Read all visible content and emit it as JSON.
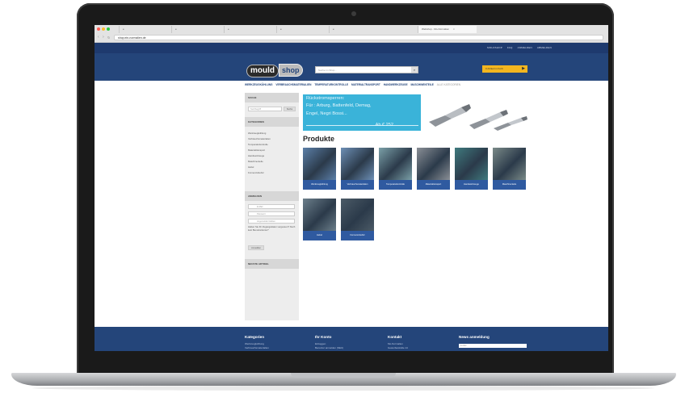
{
  "browser": {
    "tabs": [
      "e",
      "e",
      "e",
      "e",
      "e",
      "Webshop - Mo-Normalien",
      "×"
    ],
    "url": "shop.ein-normalien.de"
  },
  "site": {
    "top_links": [
      "MOLDSHOP",
      "FAQ",
      "ANMELDEN",
      "ABMELDEN"
    ],
    "logo": {
      "part1": "mould",
      "part2": "shop"
    },
    "search_placeholder": "Suche im Shop...",
    "cart_label": "0 Artikel im Korb",
    "categories_nav": [
      "WERKZEUGKÜHLUNG",
      "VERBRAUCHSMATERIALIEN",
      "TEMPERATURKONTROLLE",
      "MATERIALTRANSPORT",
      "HANDWERKZEUGE",
      "MASCHINENTEILE",
      "ALLE KATEGORIEN"
    ]
  },
  "sidebar": {
    "search_heading": "SUCHE",
    "search_placeholder": "Suchbegriff",
    "search_button": "Suche",
    "categories_heading": "KATEGORIEN",
    "categories": [
      "Werkzeugkühlung",
      "Verbrauchsmaterialien",
      "Temperaturkontrolle",
      "Materialtransport",
      "Handwerkzeuge",
      "Maschinenteile",
      "Hebel",
      "Formenzubehör"
    ],
    "login_heading": "ANMELDEN",
    "login_email_placeholder": "E-Mail",
    "login_password_placeholder": "Passwort",
    "login_remember": "Angemeldet bleiben",
    "login_text": "Haben Sie Ihr Zugangsdaten vergessen? Noch kein Benutzerkonto?",
    "login_button": "Anmelden",
    "news_heading": "NEUSTE ARTIKEL"
  },
  "banner": {
    "line1": "Rückstromsperren:",
    "line2": "Für :  Arburg, Battenfeld, Demag,",
    "line3": "Engel, Negri Bossi...",
    "price": "Ab € 252"
  },
  "products_title": "Produkte",
  "products": [
    {
      "label": "Werkzeugkühlung",
      "color": "#5b7fa8"
    },
    {
      "label": "Verbrauchsmaterialien",
      "color": "#6d8fb5"
    },
    {
      "label": "Temperaturkontrolle",
      "color": "#7ba0a8"
    },
    {
      "label": "Materialtransport",
      "color": "#8a8f96"
    },
    {
      "label": "Handwerkzeuge",
      "color": "#3f7a7e"
    },
    {
      "label": "Maschinenteile",
      "color": "#7a8a88"
    },
    {
      "label": "Hebel",
      "color": "#6b7e8a"
    },
    {
      "label": "Formenzubehör",
      "color": "#4b5a66"
    }
  ],
  "footer": {
    "col1_title": "Kategorien",
    "col1_items": [
      "Werkzeugkühlung",
      "Verbrauchsmaterialien"
    ],
    "col2_title": "Ihr Konto",
    "col2_items": [
      "Einloggen",
      "Benutzer anmelden (NEU)"
    ],
    "col3_title": "Kontakt",
    "col3_items": [
      "Mo-Normalien",
      "Gewerbestraße 14"
    ],
    "col4_title": "News anmeldung",
    "newsletter_placeholder": "E-Mail"
  }
}
